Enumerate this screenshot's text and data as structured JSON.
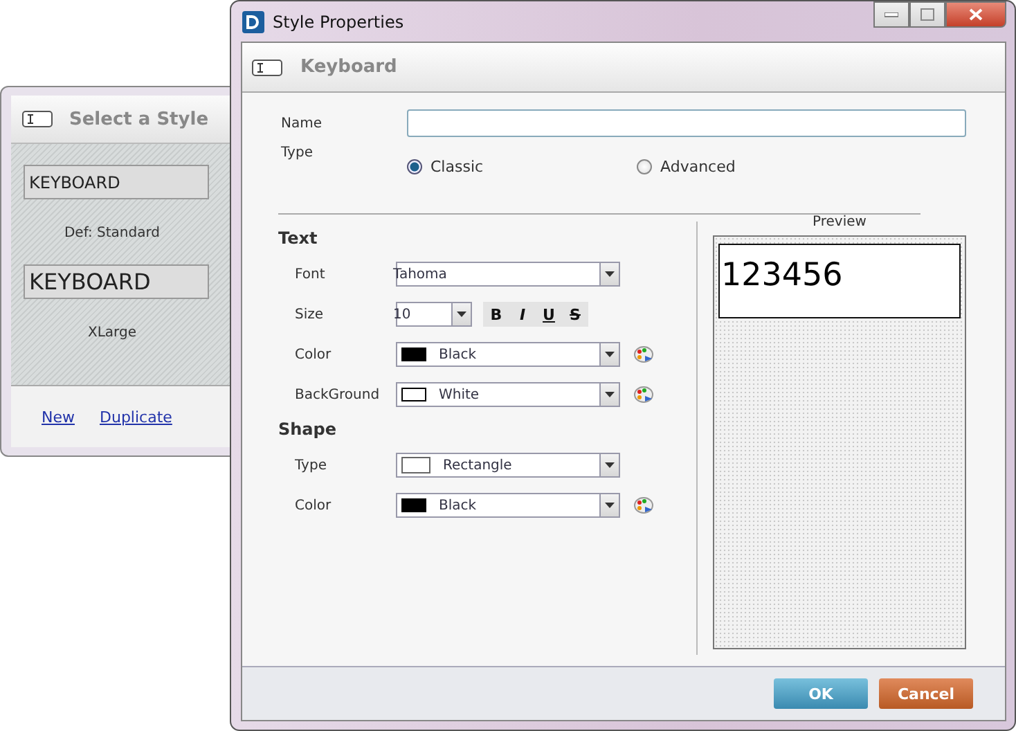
{
  "back_window": {
    "title": "Select a Style",
    "styles": [
      {
        "label": "KEYBOARD",
        "caption": "Def: Standard",
        "kind": "standard"
      },
      {
        "label": "KEYBOARD",
        "caption": "XLarge",
        "kind": "xlarge"
      }
    ],
    "links": [
      "New",
      "Duplicate"
    ]
  },
  "dialog": {
    "title": "Style Properties",
    "header": "Keyboard",
    "name": {
      "label": "Name"
    },
    "type": {
      "label": "Type",
      "options": [
        {
          "label": "Classic",
          "selected": true
        },
        {
          "label": "Advanced",
          "selected": false
        }
      ]
    },
    "sections": [
      {
        "title": "Text",
        "rows": [
          {
            "label": "Font",
            "kind": "text",
            "value": "Tahoma"
          },
          {
            "label": "Size",
            "kind": "size",
            "value": "10",
            "format": [
              {
                "label": "B",
                "selected": false
              },
              {
                "label": "I",
                "selected": false
              },
              {
                "label": "U",
                "selected": false
              },
              {
                "label": "S",
                "selected": false
              }
            ]
          },
          {
            "label": "Color",
            "kind": "color",
            "value": "Black",
            "color": "#000000"
          },
          {
            "label": "BackGround",
            "kind": "color",
            "value": "White",
            "color": "#ffffff"
          }
        ]
      },
      {
        "title": "Shape",
        "rows": [
          {
            "label": "Type",
            "kind": "shape",
            "value": "Rectangle"
          },
          {
            "label": "Color",
            "kind": "color",
            "value": "Black",
            "color": "#000000"
          }
        ]
      }
    ],
    "preview": {
      "label": "Preview",
      "text": "123456"
    },
    "buttons": [
      {
        "label": "OK",
        "kind": "primary"
      },
      {
        "label": "Cancel",
        "kind": "cancel"
      }
    ]
  }
}
